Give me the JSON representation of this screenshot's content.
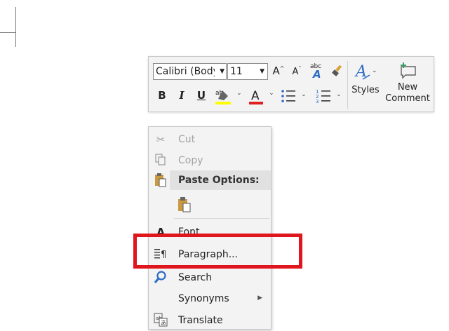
{
  "mini_toolbar": {
    "font_name": "Calibri (Body)",
    "font_size": "11",
    "styles_label": "Styles",
    "new_comment_label_1": "New",
    "new_comment_label_2": "Comment",
    "bold": "B",
    "italic": "I",
    "underline": "U",
    "font_color_glyph": "A",
    "highlight_color": "#ffff00",
    "font_color": "#e02020"
  },
  "context_menu": {
    "items": [
      {
        "label": "Cut",
        "icon": "scissors-icon",
        "disabled": true
      },
      {
        "label": "Copy",
        "icon": "copy-icon",
        "disabled": true
      },
      {
        "label": "Paste Options:",
        "icon": "clipboard-icon"
      },
      {
        "label": "Font",
        "icon": "font-icon"
      },
      {
        "label": "Paragraph...",
        "icon": "paragraph-icon"
      },
      {
        "label": "Search",
        "icon": "search-icon"
      },
      {
        "label": "Synonyms",
        "icon": "",
        "has_submenu": true
      },
      {
        "label": "Translate",
        "icon": "translate-icon"
      }
    ]
  },
  "highlight_color": "#e0161e"
}
